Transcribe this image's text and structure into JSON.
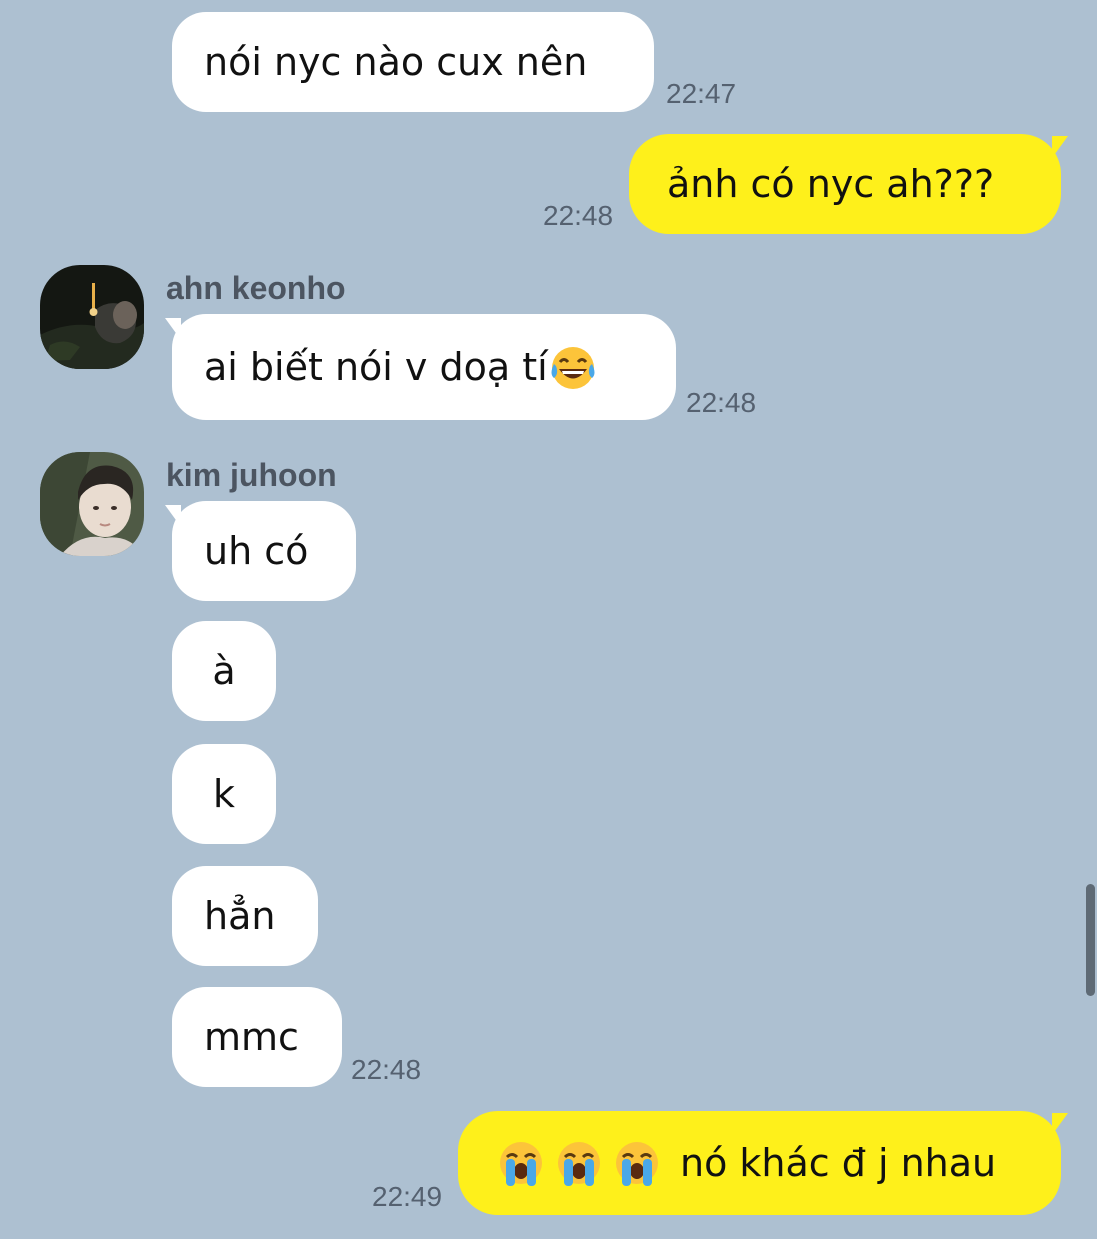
{
  "messages": [
    {
      "text": "nói nyc nào cux nên",
      "time": "22:47"
    },
    {
      "text": "ảnh có nyc ah???",
      "time": "22:48"
    },
    {
      "sender": "ahn keonho",
      "text": "ai biết nói v doạ tí",
      "emoji": "face-with-tears-of-joy-emoji",
      "time": "22:48"
    },
    {
      "sender": "kim juhoon",
      "text": "uh có"
    },
    {
      "text": "à"
    },
    {
      "text": "k"
    },
    {
      "text": "hẳn"
    },
    {
      "text": "mmc",
      "time": "22:48"
    },
    {
      "text": "nó khác đ j nhau",
      "emoji": "loudly-crying-face-emoji",
      "emoji_count": 3,
      "time": "22:49"
    }
  ],
  "colors": {
    "background": "#adc0d1",
    "received_bubble": "#ffffff",
    "sent_bubble": "#fef01b"
  }
}
